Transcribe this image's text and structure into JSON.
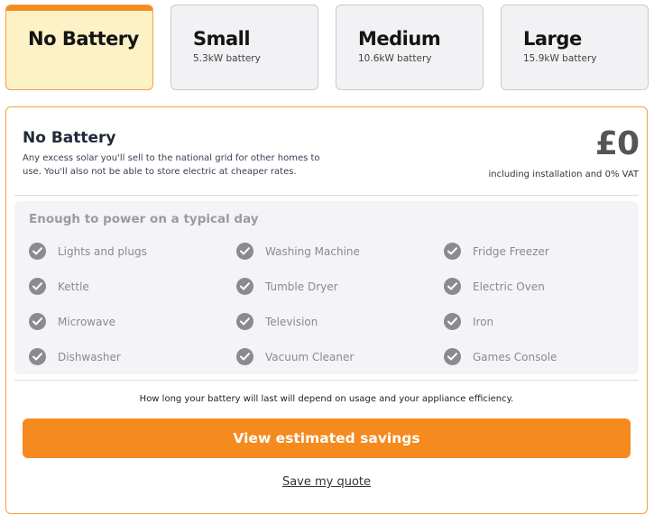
{
  "battery_options": [
    {
      "title": "No Battery",
      "subtitle": "",
      "selected": true
    },
    {
      "title": "Small",
      "subtitle": "5.3kW battery",
      "selected": false
    },
    {
      "title": "Medium",
      "subtitle": "10.6kW battery",
      "selected": false
    },
    {
      "title": "Large",
      "subtitle": "15.9kW battery",
      "selected": false
    }
  ],
  "summary": {
    "title": "No Battery",
    "description": "Any excess solar you'll sell to the national grid for other homes to use. You'll also not be able to store electric at cheaper rates.",
    "price": "£0",
    "price_note": "including installation and 0% VAT"
  },
  "appliances": {
    "heading": "Enough to power on a typical day",
    "items": [
      "Lights and plugs",
      "Washing Machine",
      "Fridge Freezer",
      "Kettle",
      "Tumble Dryer",
      "Electric Oven",
      "Microwave",
      "Television",
      "Iron",
      "Dishwasher",
      "Vacuum Cleaner",
      "Games Console"
    ]
  },
  "footer": {
    "note": "How long your battery will last will depend on usage and your appliance efficiency.",
    "cta_label": "View estimated savings",
    "save_link": "Save my quote"
  },
  "colors": {
    "accent": "#f58a1f",
    "selected_bg": "#fdf1c6",
    "check": "#8a8a8f"
  }
}
